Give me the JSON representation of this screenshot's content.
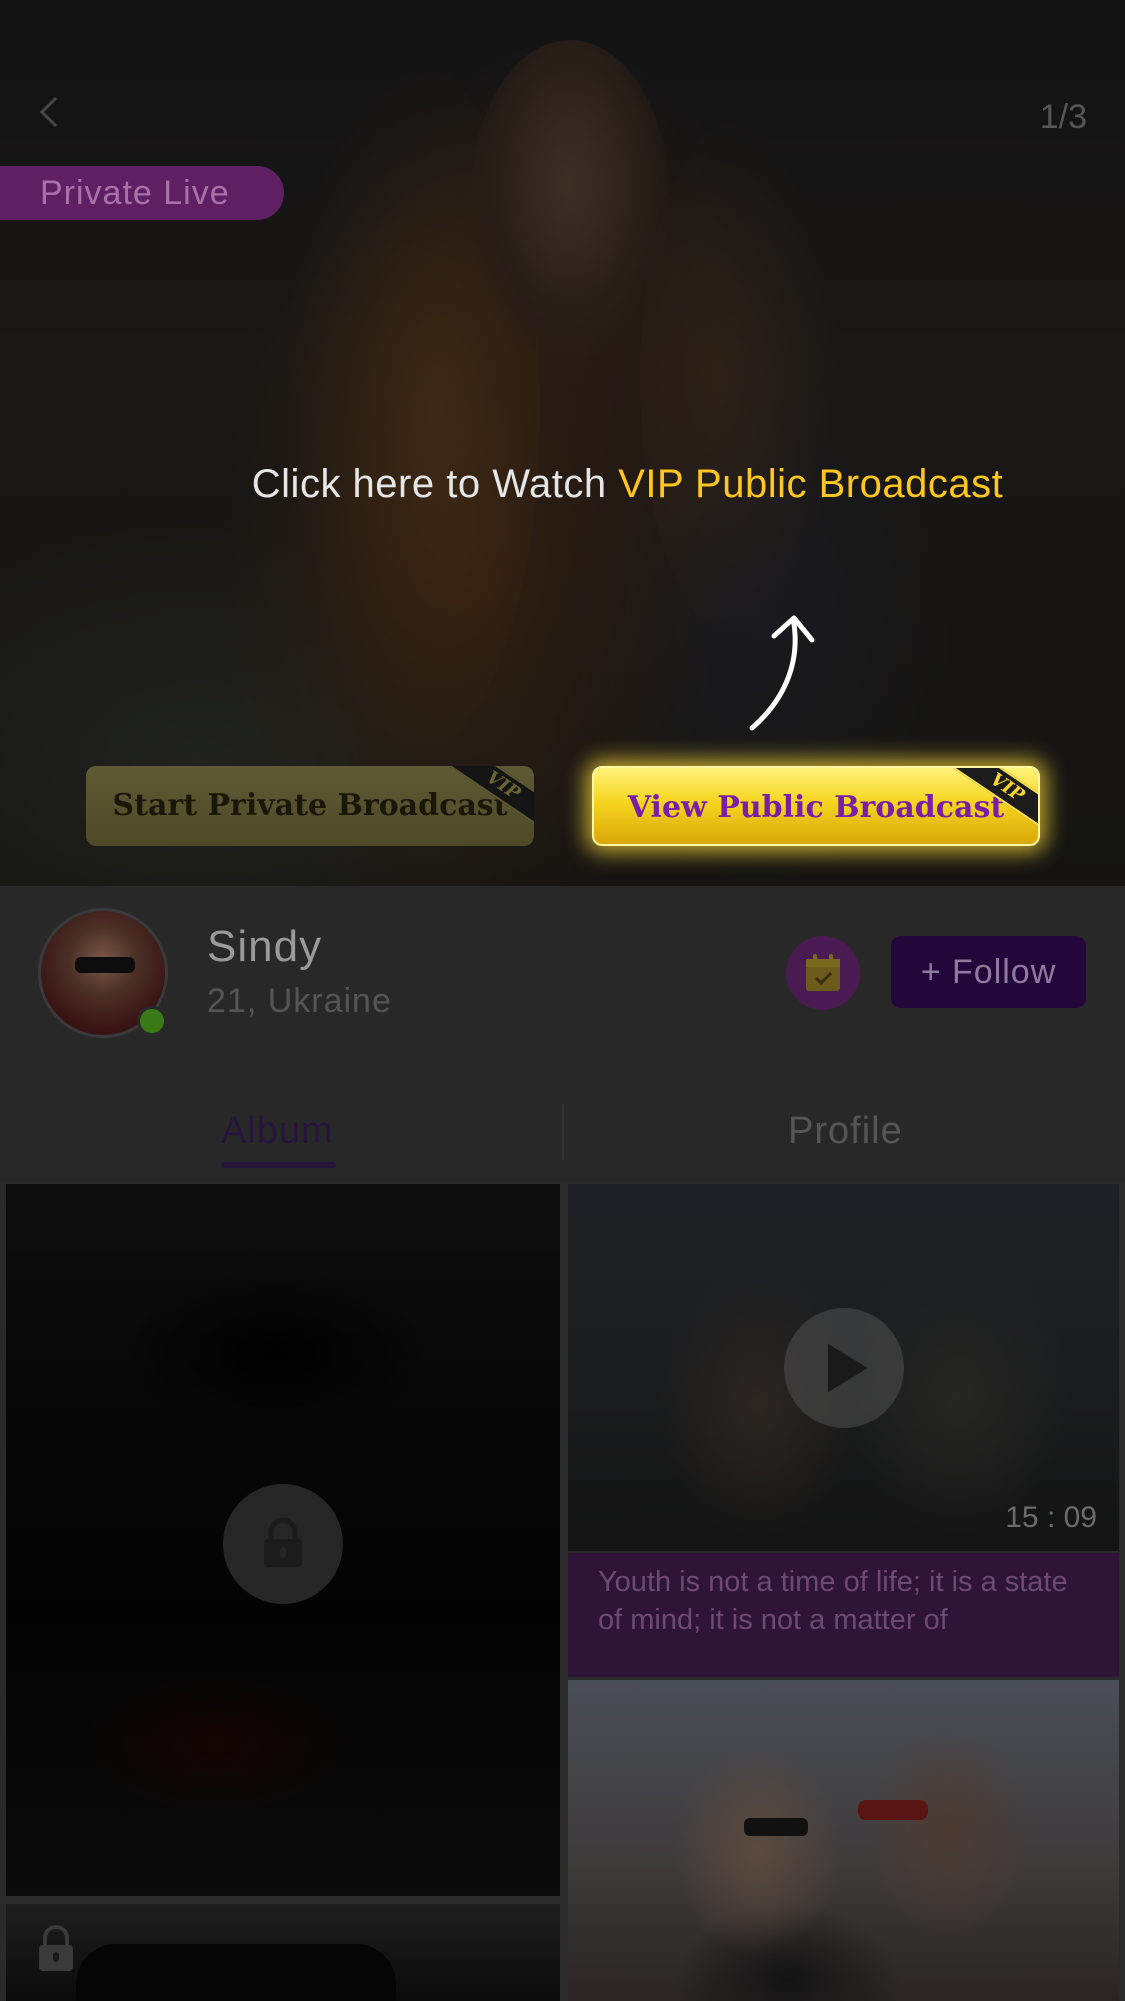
{
  "hero": {
    "page_counter": "1/3",
    "badge": "Private Live",
    "hint_prefix": "Click here to Watch ",
    "hint_highlight": "VIP Public Broadcast",
    "buttons": {
      "private": "Start Private Broadcast",
      "public": "View Public Broadcast",
      "vip_tag": "VIP"
    },
    "colors": {
      "highlight": "#ffc61e",
      "badge_bg": "#5e1f63",
      "public_btn": "#f6d51f",
      "public_btn_text": "#7a1ea8"
    }
  },
  "profile": {
    "name": "Sindy",
    "meta": "21, Ukraine",
    "follow_label": "+ Follow",
    "online": true
  },
  "tabs": [
    {
      "label": "Album",
      "active": true
    },
    {
      "label": "Profile",
      "active": false
    }
  ],
  "album": {
    "video_duration": "15 : 09",
    "quote": "Youth is not a time of life; it is a state of mind; it is not a matter of"
  },
  "icons": {
    "back": "chevron-left-icon",
    "arrow": "curved-arrow-up-icon",
    "calendar": "calendar-check-icon",
    "lock": "lock-icon",
    "play": "play-icon"
  }
}
